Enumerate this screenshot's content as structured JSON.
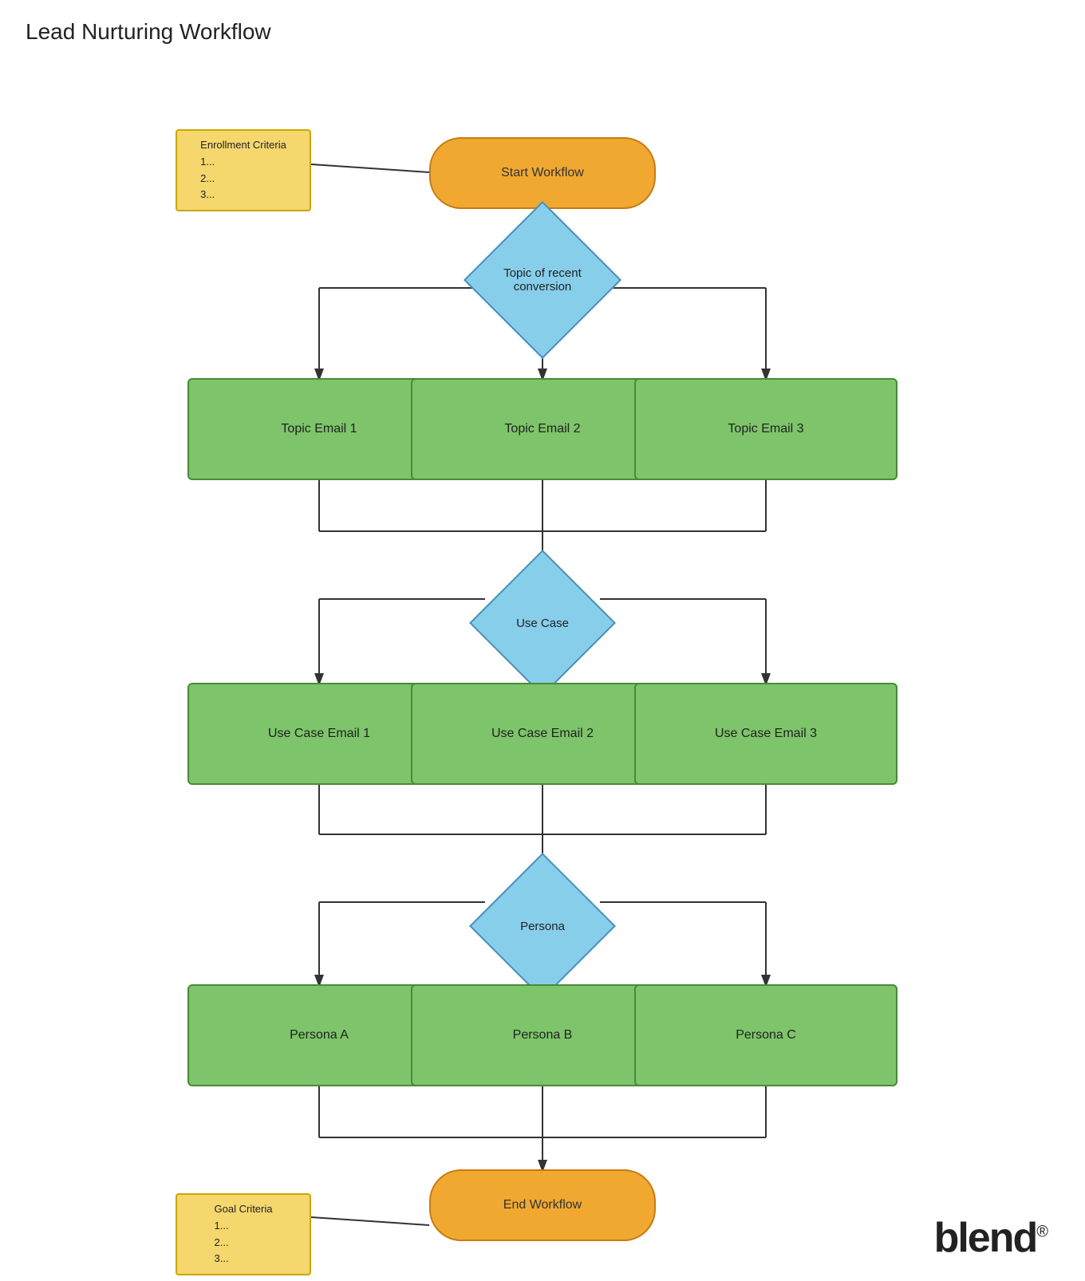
{
  "title": "Lead Nurturing Workflow",
  "nodes": {
    "startWorkflow": {
      "label": "Start Workflow"
    },
    "endWorkflow": {
      "label": "End Workflow"
    },
    "topicOfRecentConversion": {
      "label": "Topic of recent\nconversion"
    },
    "useCase": {
      "label": "Use Case"
    },
    "persona": {
      "label": "Persona"
    },
    "topicEmail1": {
      "label": "Topic Email 1"
    },
    "topicEmail2": {
      "label": "Topic Email 2"
    },
    "topicEmail3": {
      "label": "Topic Email 3"
    },
    "useCaseEmail1": {
      "label": "Use Case Email 1"
    },
    "useCaseEmail2": {
      "label": "Use Case Email 2"
    },
    "useCaseEmail3": {
      "label": "Use Case Email 3"
    },
    "personaA": {
      "label": "Persona A"
    },
    "personaB": {
      "label": "Persona B"
    },
    "personaC": {
      "label": "Persona C"
    },
    "enrollmentCriteria": {
      "label": "Enrollment Criteria\n1...\n2...\n3..."
    },
    "goalCriteria": {
      "label": "Goal Criteria\n1...\n2...\n3..."
    }
  },
  "blend": {
    "text": "blend",
    "reg": "®"
  }
}
